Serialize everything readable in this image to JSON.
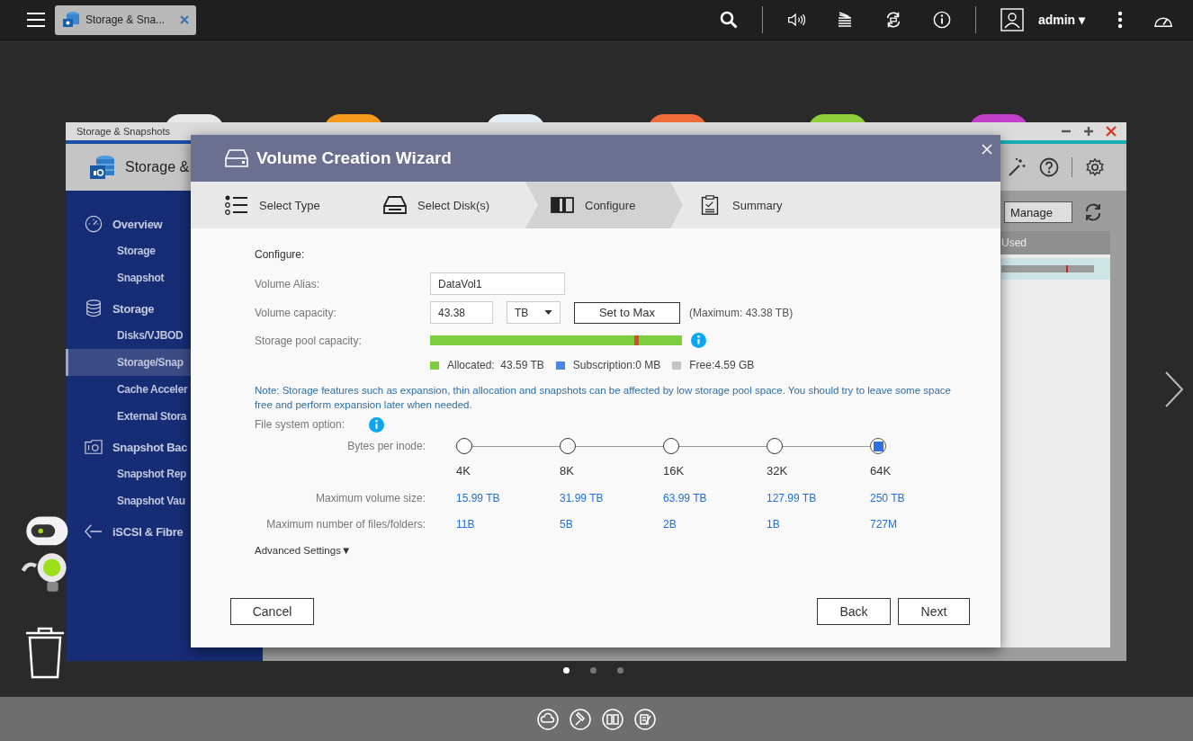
{
  "top_bar": {
    "app_tab": {
      "label": "Storage & Sna..."
    },
    "user": {
      "name": "admin",
      "caret": "▾"
    }
  },
  "storage_window": {
    "title": "Storage & Snapshots",
    "header_title": "Storage &",
    "sidebar": [
      {
        "label": "Overview",
        "children": [
          {
            "label": "Storage",
            "selected": false
          },
          {
            "label": "Snapshot",
            "selected": false
          }
        ]
      },
      {
        "label": "Storage",
        "children": [
          {
            "label": "Disks/VJBOD",
            "selected": false
          },
          {
            "label": "Storage/Snap",
            "selected": true
          },
          {
            "label": "Cache Acceler",
            "selected": false
          },
          {
            "label": "External Stora",
            "selected": false
          }
        ]
      },
      {
        "label": "Snapshot Bac",
        "children": [
          {
            "label": "Snapshot Rep",
            "selected": false
          },
          {
            "label": "Snapshot Vau",
            "selected": false
          }
        ]
      },
      {
        "label": "iSCSI & Fibre"
      }
    ],
    "manage_button": "Manage",
    "table": {
      "columns": [
        "Used"
      ]
    }
  },
  "wizard": {
    "title": "Volume Creation Wizard",
    "steps": [
      {
        "label": "Select Type",
        "selected": false
      },
      {
        "label": "Select Disk(s)",
        "selected": false
      },
      {
        "label": "Configure",
        "selected": true
      },
      {
        "label": "Summary",
        "selected": false
      }
    ],
    "section_title": "Configure:",
    "alias": {
      "label": "Volume Alias:",
      "value": "DataVol1"
    },
    "capacity": {
      "label": "Volume capacity:",
      "value": "43.38",
      "unit": "TB",
      "set_max_button": "Set to Max",
      "maximum": "(Maximum: 43.38 TB)"
    },
    "pool": {
      "label": "Storage pool capacity:",
      "level": 1,
      "marker": {
        "level": 0.81
      },
      "legend": [
        {
          "label": "Allocated:  43.59 TB",
          "color": "#7dcd3e"
        },
        {
          "label": "Subscription:0 MB",
          "color": "#4a86e8"
        },
        {
          "label": "Free:4.59 GB",
          "color": "#c4c4c4"
        }
      ]
    },
    "note": "Note: Storage features such as expansion, thin allocation and snapshots can be affected by low storage pool space. You should try to leave some space free and perform expansion later when needed.",
    "file_system": {
      "label": "File system option:",
      "inode_label": "Bytes per inode:",
      "max_volume_label": "Maximum volume size:",
      "max_files_label": "Maximum number of files/folders:",
      "options": [
        {
          "label": "4K",
          "selected": false,
          "max_volume": "15.99 TB",
          "max_files": "11B"
        },
        {
          "label": "8K",
          "selected": false,
          "max_volume": "31.99 TB",
          "max_files": "5B"
        },
        {
          "label": "16K",
          "selected": false,
          "max_volume": "63.99 TB",
          "max_files": "2B"
        },
        {
          "label": "32K",
          "selected": false,
          "max_volume": "127.99 TB",
          "max_files": "1B"
        },
        {
          "label": "64K",
          "selected": true,
          "max_volume": "250 TB",
          "max_files": "727M"
        }
      ]
    },
    "advanced": {
      "label": "Advanced Settings",
      "caret": "▼"
    },
    "buttons": {
      "cancel": "Cancel",
      "back": "Back",
      "next": "Next"
    }
  },
  "desktop": {
    "page_dots": [
      {
        "selected": true
      },
      {
        "selected": false
      },
      {
        "selected": false
      }
    ]
  }
}
